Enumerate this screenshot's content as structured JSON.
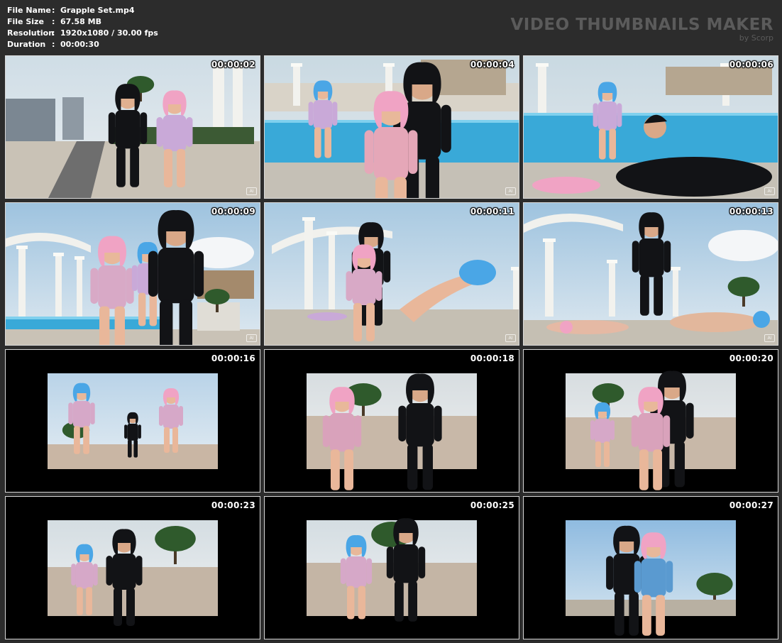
{
  "file_info": {
    "rows": [
      {
        "label": "File Name",
        "sep": ":",
        "value": "Grapple Set.mp4"
      },
      {
        "label": "File Size",
        "sep": ":",
        "value": "67.58 MB"
      },
      {
        "label": "Resolution",
        "sep": ":",
        "value": "1920x1080 / 30.00 fps"
      },
      {
        "label": "Duration",
        "sep": ":",
        "value": "00:00:30"
      }
    ]
  },
  "brand": {
    "title": "VIDEO THUMBNAILS MAKER",
    "subtitle": "by Scorp"
  },
  "thumbnails": [
    {
      "timestamp": "00:00:02",
      "scene": "rooftop-courtyard-chase",
      "ai_mark": "AI"
    },
    {
      "timestamp": "00:00:04",
      "scene": "poolside-chokehold",
      "ai_mark": "AI"
    },
    {
      "timestamp": "00:00:06",
      "scene": "poolside-takedown",
      "ai_mark": "AI"
    },
    {
      "timestamp": "00:00:09",
      "scene": "colonnade-struggle",
      "ai_mark": "AI"
    },
    {
      "timestamp": "00:00:11",
      "scene": "colonnade-kick",
      "ai_mark": "AI"
    },
    {
      "timestamp": "00:00:13",
      "scene": "colonnade-defeated",
      "ai_mark": "AI"
    },
    {
      "timestamp": "00:00:16",
      "scene": "plaza-standoff",
      "ai_mark": ""
    },
    {
      "timestamp": "00:00:18",
      "scene": "plaza-strike",
      "ai_mark": ""
    },
    {
      "timestamp": "00:00:20",
      "scene": "plaza-grab",
      "ai_mark": ""
    },
    {
      "timestamp": "00:00:23",
      "scene": "plaza-face-off",
      "ai_mark": ""
    },
    {
      "timestamp": "00:00:25",
      "scene": "plaza-lunge",
      "ai_mark": ""
    },
    {
      "timestamp": "00:00:27",
      "scene": "plaza-headlock",
      "ai_mark": ""
    }
  ],
  "colors": {
    "background": "#2c2c2c",
    "cell_border": "#d8d8d8",
    "text": "#ffffff",
    "brand": "#5b5b5b"
  }
}
